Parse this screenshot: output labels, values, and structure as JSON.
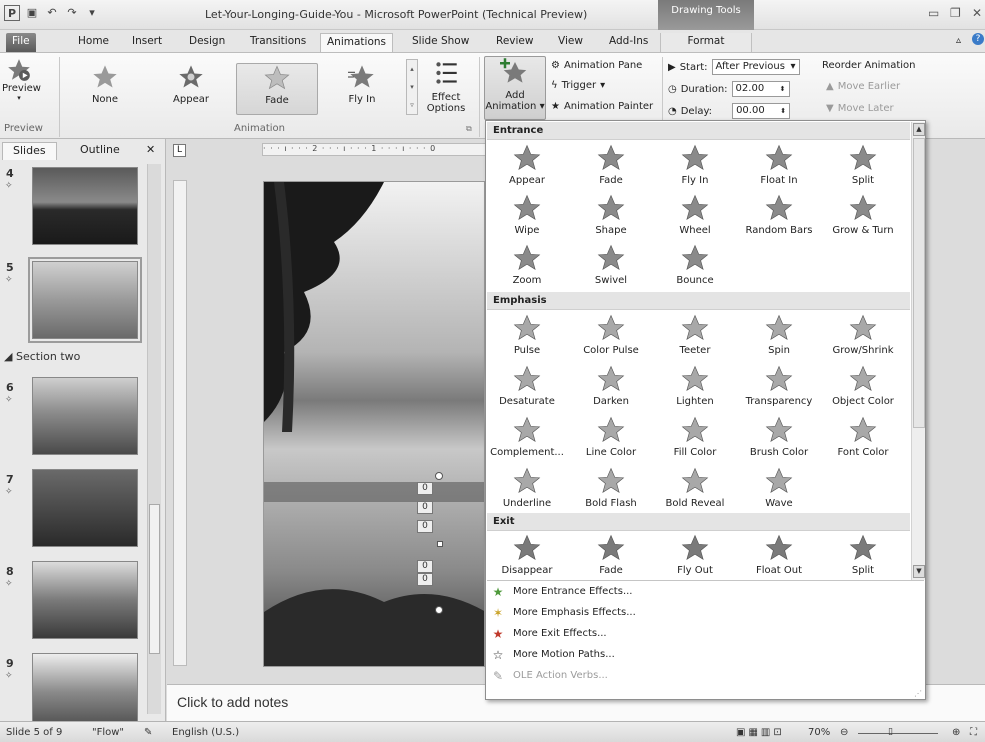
{
  "window": {
    "title": "Let-Your-Longing-Guide-You - Microsoft PowerPoint (Technical Preview)",
    "context_tab_group": "Drawing Tools"
  },
  "tabs": [
    "File",
    "Home",
    "Insert",
    "Design",
    "Transitions",
    "Animations",
    "Slide Show",
    "Review",
    "View",
    "Add-Ins",
    "Format"
  ],
  "ribbon": {
    "preview": {
      "label": "Preview",
      "group": "Preview"
    },
    "animation_group": "Animation",
    "gallery": [
      "None",
      "Appear",
      "Fade",
      "Fly In"
    ],
    "effect_options": [
      "Effect",
      "Options"
    ],
    "add_animation": [
      "Add",
      "Animation"
    ],
    "animation_pane": "Animation Pane",
    "trigger": "Trigger",
    "animation_painter": "Animation Painter",
    "start_label": "Start:",
    "start_value": "After Previous",
    "duration_label": "Duration:",
    "duration_value": "02.00",
    "delay_label": "Delay:",
    "delay_value": "00.00",
    "reorder": "Reorder Animation",
    "move_earlier": "Move Earlier",
    "move_later": "Move Later"
  },
  "left_panel": {
    "tabs": [
      "Slides",
      "Outline"
    ],
    "section": "Section two",
    "slide_numbers": [
      "4",
      "5",
      "6",
      "7",
      "8",
      "9"
    ]
  },
  "ruler": {
    "text": "· · · ı · · · 2 · · · ı · · · 1 · · · ı · · · 0"
  },
  "slide_tags": [
    "0",
    "0",
    "0",
    "0",
    "0"
  ],
  "notes": {
    "placeholder": "Click to add notes"
  },
  "dropdown": {
    "entrance": {
      "header": "Entrance",
      "items": [
        "Appear",
        "Fade",
        "Fly In",
        "Float In",
        "Split",
        "Wipe",
        "Shape",
        "Wheel",
        "Random Bars",
        "Grow & Turn",
        "Zoom",
        "Swivel",
        "Bounce"
      ]
    },
    "emphasis": {
      "header": "Emphasis",
      "items": [
        "Pulse",
        "Color Pulse",
        "Teeter",
        "Spin",
        "Grow/Shrink",
        "Desaturate",
        "Darken",
        "Lighten",
        "Transparency",
        "Object Color",
        "Complement...",
        "Line Color",
        "Fill Color",
        "Brush Color",
        "Font Color",
        "Underline",
        "Bold Flash",
        "Bold Reveal",
        "Wave"
      ]
    },
    "exit": {
      "header": "Exit",
      "items": [
        "Disappear",
        "Fade",
        "Fly Out",
        "Float Out",
        "Split"
      ]
    },
    "more": [
      "More Entrance Effects...",
      "More Emphasis Effects...",
      "More Exit Effects...",
      "More Motion Paths...",
      "OLE Action Verbs..."
    ]
  },
  "statusbar": {
    "slide": "Slide 5 of 9",
    "theme": "\"Flow\"",
    "language": "English (U.S.)",
    "zoom": "70%"
  },
  "colors": {
    "entrance_star": "#4f9a3c",
    "emphasis_star": "#c9a227",
    "exit_star": "#c0392b"
  }
}
